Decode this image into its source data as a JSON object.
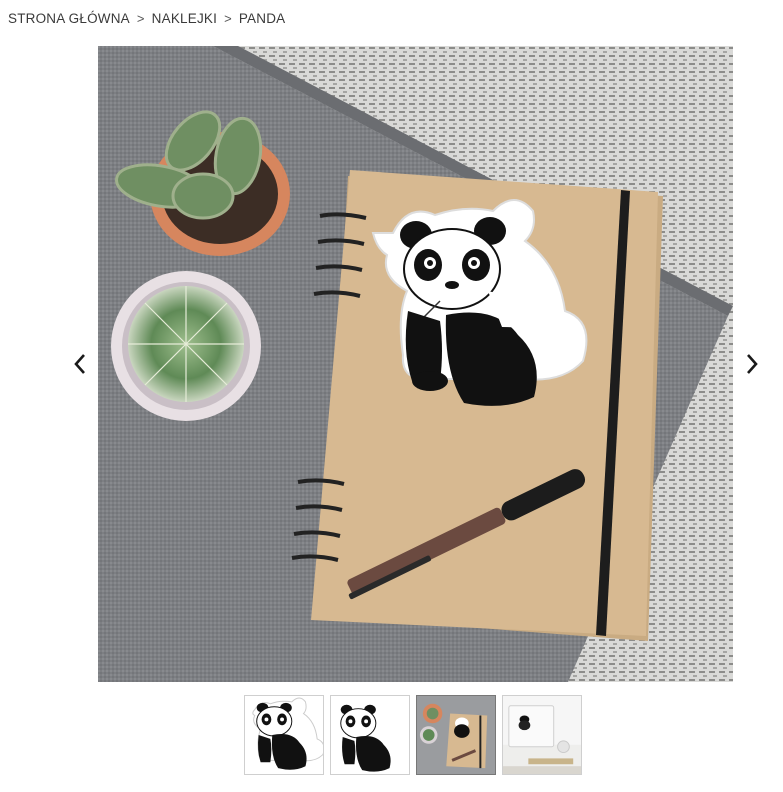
{
  "breadcrumb": {
    "items": [
      {
        "label": "STRONA GŁÓWNA"
      },
      {
        "label": "NAKLEJKI"
      },
      {
        "label": "PANDA"
      }
    ],
    "separator": ">"
  },
  "gallery": {
    "prev_icon": "chevron-left-icon",
    "next_icon": "chevron-right-icon",
    "main_image": "panda sticker on kraft notebook with cacti and pen",
    "thumbnails": [
      {
        "image": "panda sticker with white outline"
      },
      {
        "image": "panda design without outline"
      },
      {
        "image": "panda sticker on notebook",
        "selected": true
      },
      {
        "image": "panda sticker on laptop"
      }
    ]
  }
}
